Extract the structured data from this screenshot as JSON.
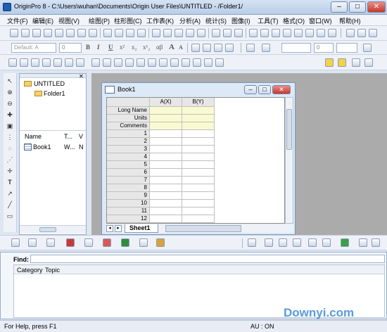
{
  "window": {
    "title": "OriginPro 8 - C:\\Users\\wuhan\\Documents\\Origin User Files\\UNTITLED - /Folder1/",
    "minimize": "–",
    "maximize": "□",
    "close": "✕"
  },
  "menu": [
    {
      "label": "文件(F)"
    },
    {
      "label": "编辑(E)"
    },
    {
      "label": "视图(V)"
    },
    {
      "label": "绘图(P)"
    },
    {
      "label": "柱形图(C)"
    },
    {
      "label": "工作表(K)"
    },
    {
      "label": "分析(A)"
    },
    {
      "label": "统计(S)"
    },
    {
      "label": "图像(I)"
    },
    {
      "label": "工具(T)"
    },
    {
      "label": "格式(O)"
    },
    {
      "label": "窗口(W)"
    },
    {
      "label": "帮助(H)"
    }
  ],
  "format_toolbar": {
    "font_value": "Default: A",
    "size_value": "0",
    "second_size": "0",
    "bold": "B",
    "italic": "I",
    "underline": "U",
    "superscript": "x²",
    "subscript": "x₂",
    "supsub": "x¹₂",
    "greek": "αβ",
    "grow_font": "A",
    "shrink_font": "A"
  },
  "project_explorer": {
    "root": "UNTITLED",
    "folder": "Folder1",
    "columns": {
      "name": "Name",
      "type": "T...",
      "view": "V"
    },
    "items": [
      {
        "name": "Book1",
        "type": "W...",
        "view": "N"
      }
    ]
  },
  "workbook": {
    "title": "Book1",
    "columns": [
      "A(X)",
      "B(Y)"
    ],
    "label_rows": [
      "Long Name",
      "Units",
      "Comments"
    ],
    "rows": [
      "1",
      "2",
      "3",
      "4",
      "5",
      "6",
      "7",
      "8",
      "9",
      "10",
      "11",
      "12"
    ],
    "sheet_tab": "Sheet1"
  },
  "script": {
    "find_label": "Find:",
    "find_value": "",
    "tabs": [
      "Category",
      "Topic"
    ]
  },
  "status": {
    "left": "For Help, press F1",
    "right": "AU : ON"
  },
  "watermark": "Downyi.com",
  "colors": {
    "title_bar": "#c9daf0",
    "label_rows": "#fafad2",
    "workspace": "#ababab",
    "close_button": "#d9493e"
  }
}
